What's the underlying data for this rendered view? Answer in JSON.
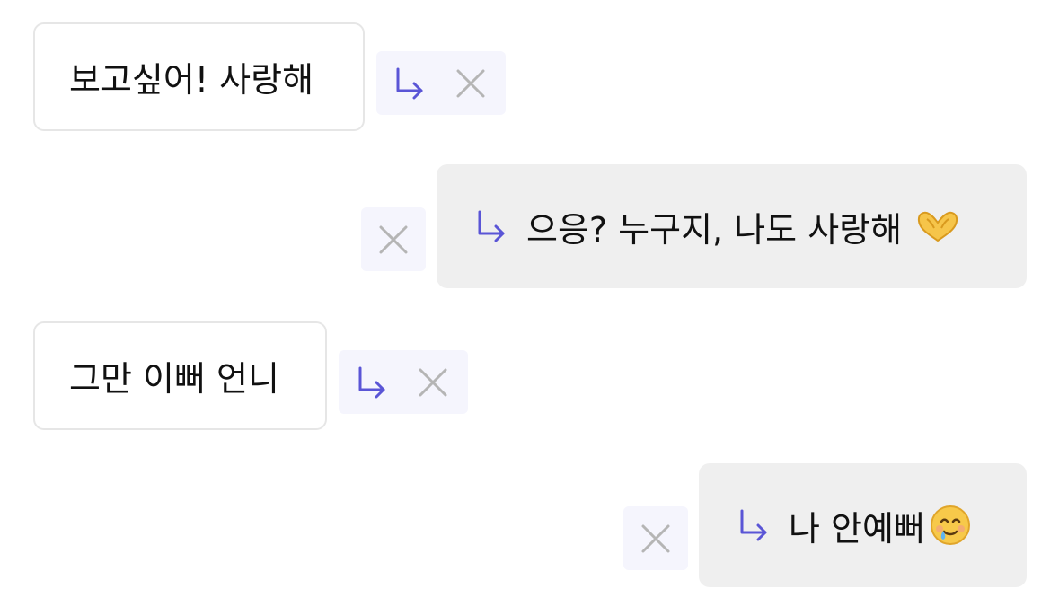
{
  "colors": {
    "accent": "#5a55d6",
    "close": "#b5b5b5",
    "outgoing_bg": "#efefef",
    "incoming_border": "#e6e6e6",
    "action_bg": "#f5f5fd"
  },
  "messages": [
    {
      "direction": "incoming",
      "text": "보고싶어! 사랑해"
    },
    {
      "direction": "outgoing",
      "text": "으응? 누구지, 나도 사랑해",
      "emoji": "heart-hands-icon"
    },
    {
      "direction": "incoming",
      "text": "그만 이뻐 언니"
    },
    {
      "direction": "outgoing",
      "text": "나 안예뻐",
      "emoji": "smiling-face-with-tear-icon"
    }
  ]
}
